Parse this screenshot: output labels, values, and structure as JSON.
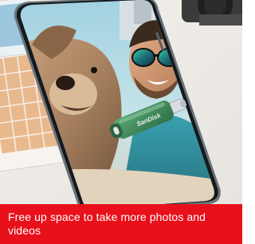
{
  "photo": {
    "subject": "usb-flash-drive-icon",
    "drive_brand_text": "SanDisk",
    "drive_color": "#3f8a5a"
  },
  "caption": {
    "text": "Free up space to take more photos and videos",
    "background_color": "#e8101a",
    "text_color": "#ffffff"
  }
}
